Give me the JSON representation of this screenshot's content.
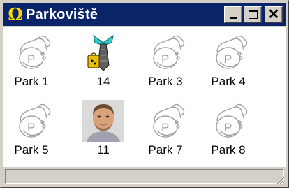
{
  "window": {
    "title": "Parkoviště",
    "title_icon": "omega-icon"
  },
  "titlebar_buttons": [
    {
      "name": "minimize-button",
      "icon": "minimize-icon"
    },
    {
      "name": "maximize-button",
      "icon": "maximize-icon"
    },
    {
      "name": "close-button",
      "icon": "close-icon",
      "glyph": "✕"
    }
  ],
  "tiles": [
    {
      "label": "Park 1",
      "icon": "parking-telephone-icon"
    },
    {
      "label": "14",
      "icon": "tie-bag-person-icon"
    },
    {
      "label": "Park 3",
      "icon": "parking-telephone-icon"
    },
    {
      "label": "Park 4",
      "icon": "parking-telephone-icon"
    },
    {
      "label": "Park 5",
      "icon": "parking-telephone-icon"
    },
    {
      "label": "11",
      "icon": "person-photo-avatar"
    },
    {
      "label": "Park 7",
      "icon": "parking-telephone-icon"
    },
    {
      "label": "Park 8",
      "icon": "parking-telephone-icon"
    }
  ],
  "statusbar": {
    "text": "",
    "grip_icon": "resize-grip-icon"
  },
  "colors": {
    "titlebar": "#0a246a",
    "title_icon": "#ffd700",
    "face": "#d4d0c8"
  }
}
